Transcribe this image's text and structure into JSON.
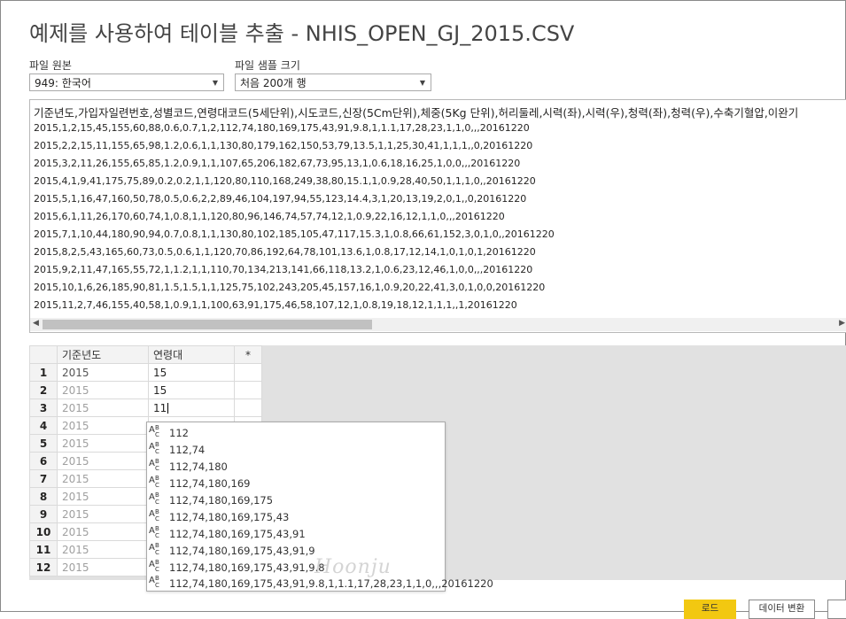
{
  "title": "예제를 사용하여 테이블 추출 - NHIS_OPEN_GJ_2015.CSV",
  "file_origin": {
    "label": "파일 원본",
    "value": "949: 한국어"
  },
  "sample_size": {
    "label": "파일 샘플 크기",
    "value": "처음 200개 행"
  },
  "preview_lines": [
    "기준년도,가입자일련번호,성별코드,연령대코드(5세단위),시도코드,신장(5Cm단위),체중(5Kg 단위),허리둘레,시력(좌),시력(우),청력(좌),청력(우),수축기혈압,이완기",
    "2015,1,2,15,45,155,60,88,0.6,0.7,1,2,112,74,180,169,175,43,91,9.8,1,1.1,17,28,23,1,1,0,,,20161220",
    "2015,2,2,15,11,155,65,98,1.2,0.6,1,1,130,80,179,162,150,53,79,13.5,1,1,25,30,41,1,1,1,,0,20161220",
    "2015,3,2,11,26,155,65,85,1.2,0.9,1,1,107,65,206,182,67,73,95,13,1,0.6,18,16,25,1,0,0,,,20161220",
    "2015,4,1,9,41,175,75,89,0.2,0.2,1,1,120,80,110,168,249,38,80,15.1,1,0.9,28,40,50,1,1,1,0,,20161220",
    "2015,5,1,16,47,160,50,78,0.5,0.6,2,2,89,46,104,197,94,55,123,14.4,3,1,20,13,19,2,0,1,,0,20161220",
    "2015,6,1,11,26,170,60,74,1,0.8,1,1,120,80,96,146,74,57,74,12,1,0.9,22,16,12,1,1,0,,,20161220",
    "2015,7,1,10,44,180,90,94,0.7,0.8,1,1,130,80,102,185,105,47,117,15.3,1,0.8,66,61,152,3,0,1,0,,20161220",
    "2015,8,2,5,43,165,60,73,0.5,0.6,1,1,120,70,86,192,64,78,101,13.6,1,0.8,17,12,14,1,0,1,0,1,20161220",
    "2015,9,2,11,47,165,55,72,1,1.2,1,1,110,70,134,213,141,66,118,13.2,1,0.6,23,12,46,1,0,0,,,20161220",
    "2015,10,1,6,26,185,90,81,1.5,1.5,1,1,125,75,102,243,205,45,157,16,1,0.9,20,22,41,3,0,1,0,0,20161220",
    "2015,11,2,7,46,155,40,58,1,0.9,1,1,100,63,91,175,46,58,107,12,1,0.8,19,18,12,1,1,1,,1,20161220"
  ],
  "grid": {
    "headers": [
      "기준년도",
      "연령대",
      "*"
    ],
    "rows": [
      {
        "n": "1",
        "year": "2015",
        "age": "15"
      },
      {
        "n": "2",
        "year": "2015",
        "age": "15"
      },
      {
        "n": "3",
        "year": "2015",
        "age": "11"
      },
      {
        "n": "4",
        "year": "2015",
        "age": ""
      },
      {
        "n": "5",
        "year": "2015",
        "age": ""
      },
      {
        "n": "6",
        "year": "2015",
        "age": ""
      },
      {
        "n": "7",
        "year": "2015",
        "age": ""
      },
      {
        "n": "8",
        "year": "2015",
        "age": ""
      },
      {
        "n": "9",
        "year": "2015",
        "age": ""
      },
      {
        "n": "10",
        "year": "2015",
        "age": ""
      },
      {
        "n": "11",
        "year": "2015",
        "age": ""
      },
      {
        "n": "12",
        "year": "2015",
        "age": ""
      }
    ]
  },
  "suggestions": [
    "112",
    "112,74",
    "112,74,180",
    "112,74,180,169",
    "112,74,180,169,175",
    "112,74,180,169,175,43",
    "112,74,180,169,175,43,91",
    "112,74,180,169,175,43,91,9",
    "112,74,180,169,175,43,91,9.8",
    "112,74,180,169,175,43,91,9.8,1,1.1,17,28,23,1,1,0,,,20161220"
  ],
  "suggestion_type_icon": {
    "a": "A",
    "b": "B",
    "c": "C"
  },
  "watermark": "Hoonju",
  "buttons": {
    "load": "로드",
    "transform": "데이터 변환"
  },
  "colors": {
    "accent": "#f2c811"
  }
}
